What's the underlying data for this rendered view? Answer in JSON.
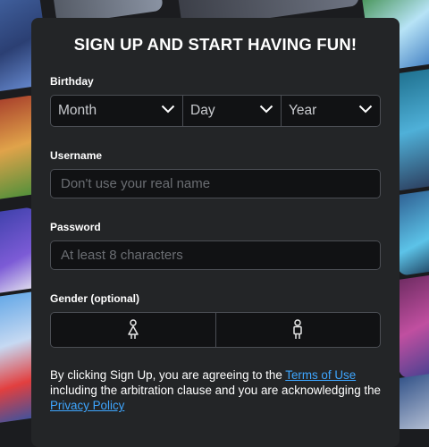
{
  "form": {
    "title": "SIGN UP AND START HAVING FUN!",
    "birthday": {
      "label": "Birthday",
      "month": "Month",
      "day": "Day",
      "year": "Year"
    },
    "username": {
      "label": "Username",
      "placeholder": "Don't use your real name",
      "value": ""
    },
    "password": {
      "label": "Password",
      "placeholder": "At least 8 characters",
      "value": ""
    },
    "gender": {
      "label": "Gender (optional)",
      "options": [
        {
          "icon": "female-icon"
        },
        {
          "icon": "male-icon"
        }
      ]
    },
    "terms": {
      "part1": "By clicking Sign Up, you are agreeing to the ",
      "terms_link": "Terms of Use",
      "part2": " including the arbitration clause and you are acknowledging the ",
      "privacy_link": "Privacy Policy"
    }
  },
  "colors": {
    "card_bg": "#232527",
    "field_bg": "#111214",
    "link": "#3ea6ff"
  }
}
